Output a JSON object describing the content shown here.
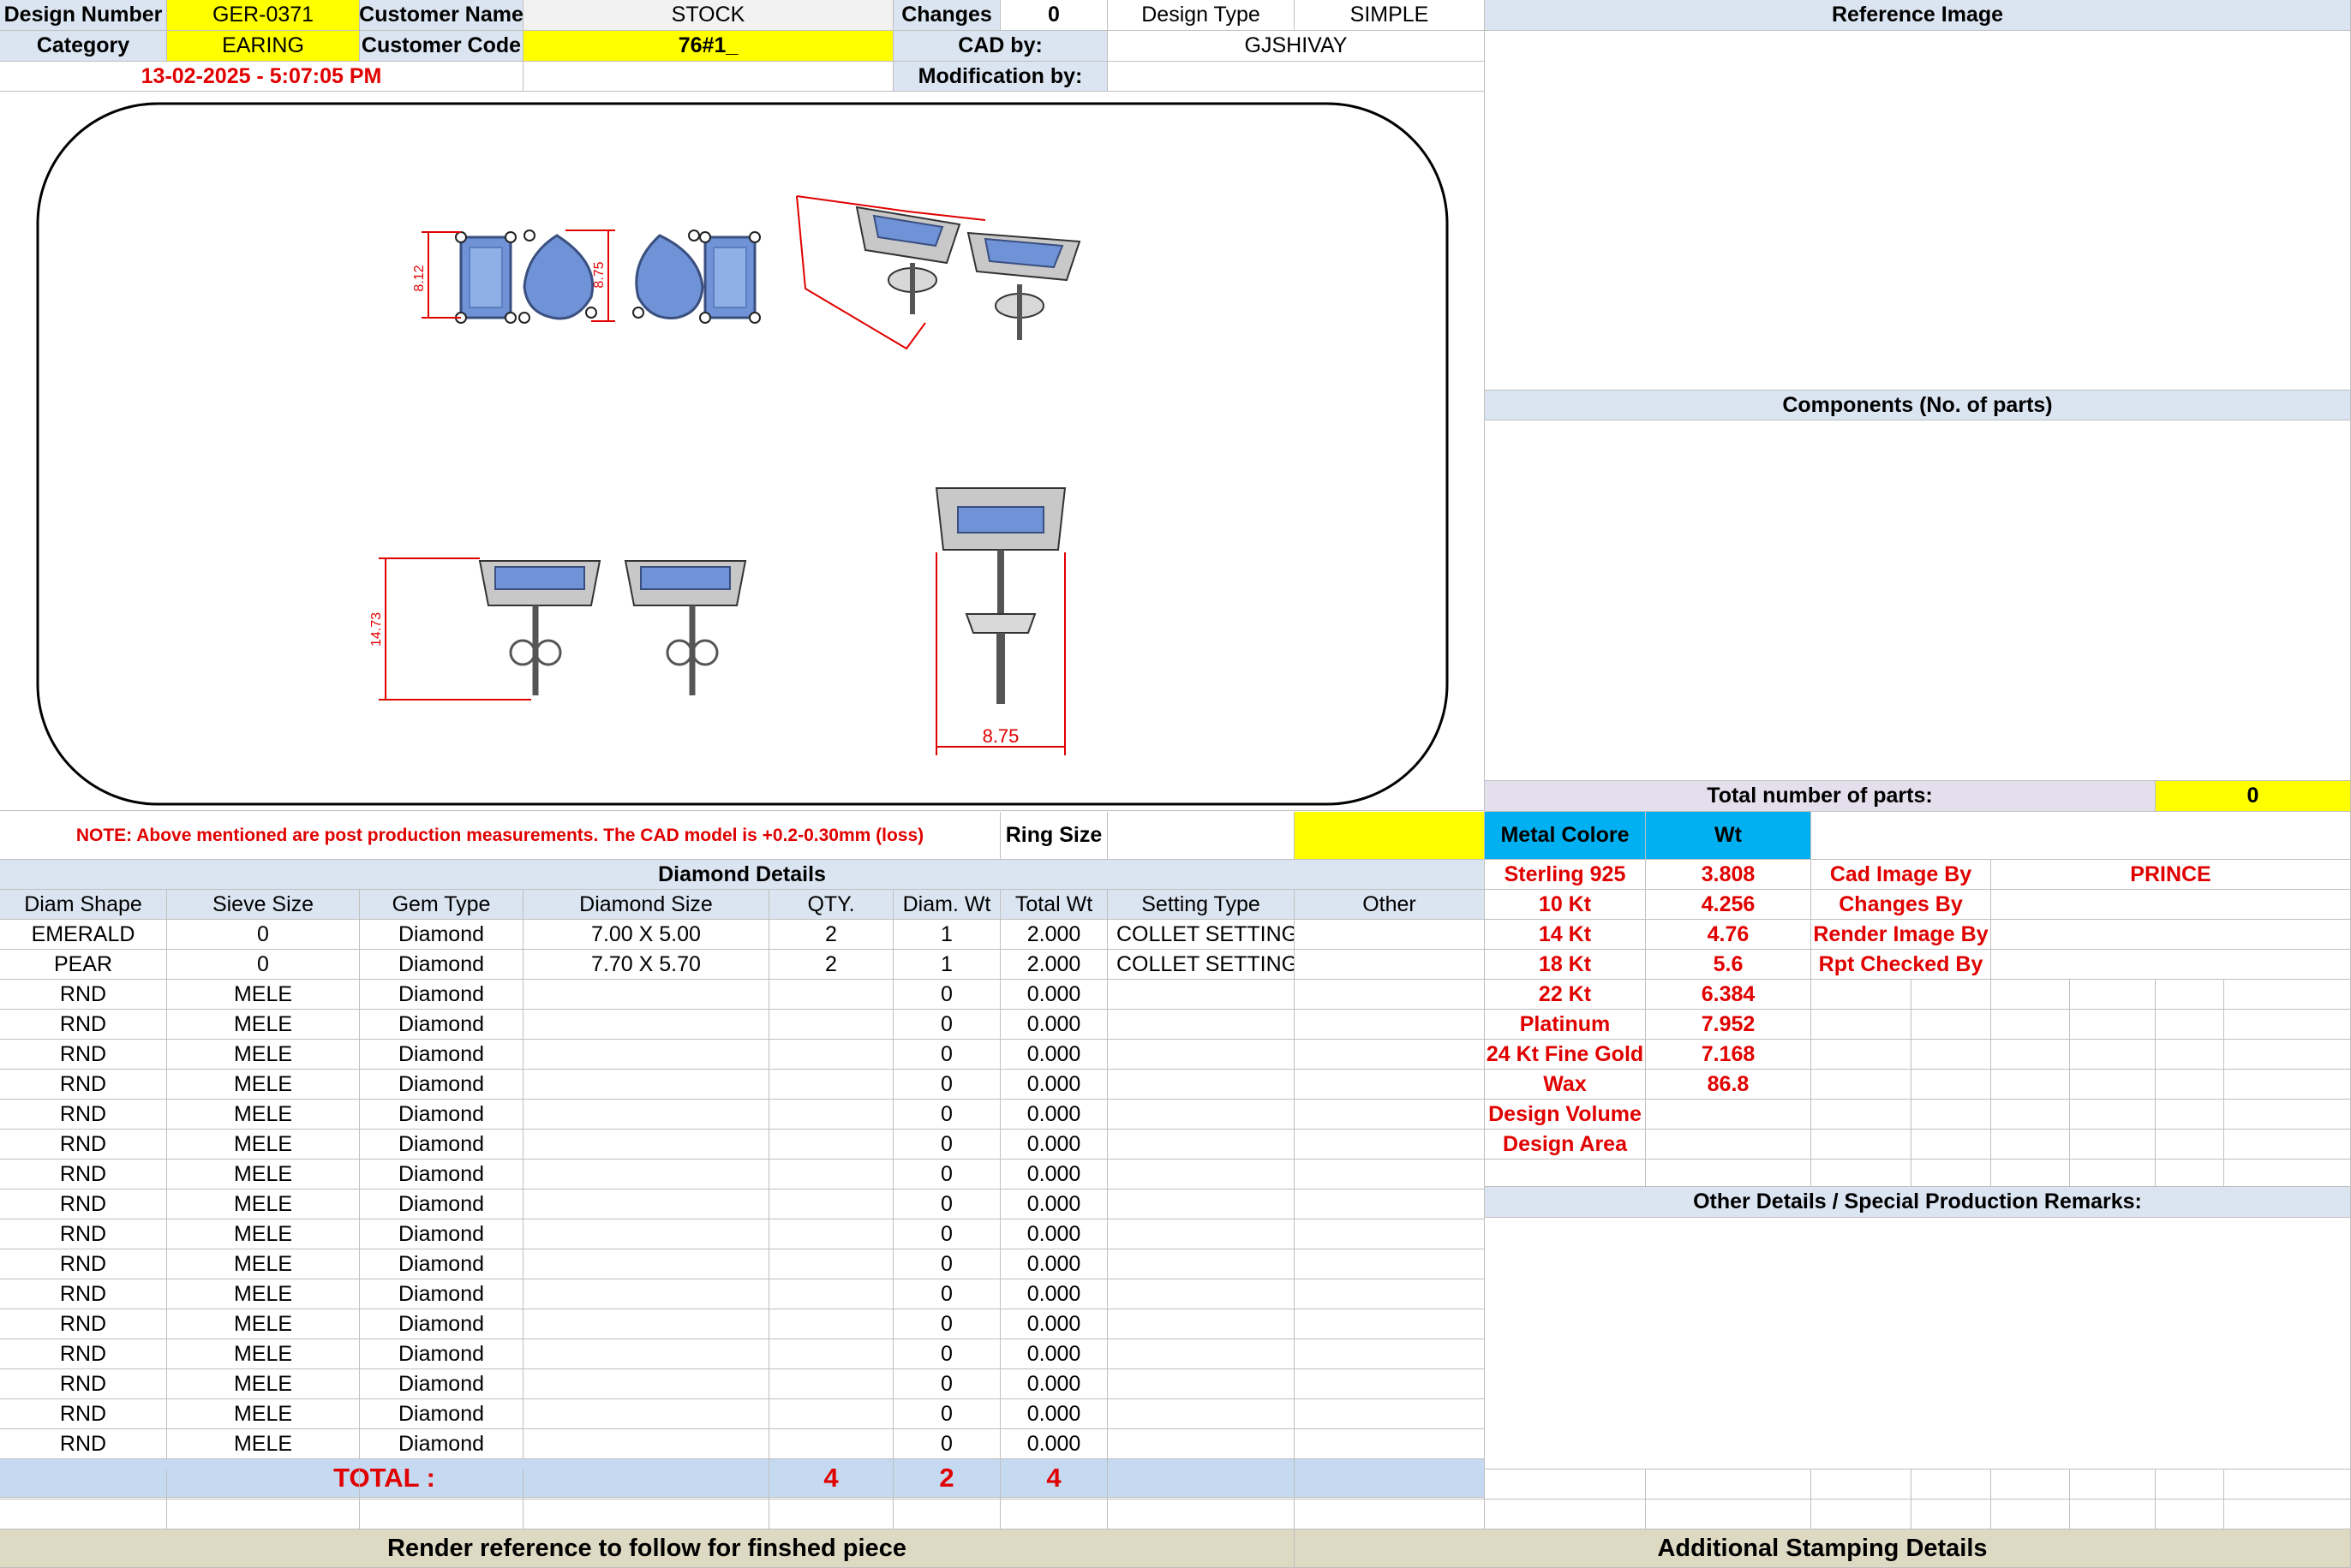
{
  "header": {
    "design_number_label": "Design Number",
    "design_number": "GER-0371",
    "customer_name_label": "Customer Name",
    "customer_name": "STOCK",
    "changes_label": "Changes",
    "changes": "0",
    "design_type_label": "Design Type",
    "design_type": "SIMPLE",
    "reference_image_label": "Reference Image",
    "category_label": "Category",
    "category": "EARING",
    "customer_code_label": "Customer Code",
    "customer_code": "76#1_",
    "cad_by_label": "CAD by:",
    "cad_by": "GJSHIVAY",
    "datetime": "13-02-2025 - 5:07:05 PM",
    "modification_by_label": "Modification by:",
    "modification_by": ""
  },
  "drawing": {
    "dim_height_1": "8.12",
    "dim_height_2": "8.75",
    "dim_side": "14.73",
    "dim_width": "8.75",
    "stone_color": "#6f93d6",
    "metal_color": "#c8c8c8",
    "dim_color": "#e00000"
  },
  "components": {
    "title": "Components (No. of parts)",
    "total_parts_label": "Total number of parts:",
    "total_parts": "0"
  },
  "note": {
    "text": "NOTE: Above mentioned are post production measurements. The CAD model is +0.2-0.30mm (loss)",
    "ring_size_label": "Ring Size",
    "ring_size": ""
  },
  "metal": {
    "colore_label": "Metal Colore",
    "wt_label": "Wt",
    "rows": [
      {
        "name": "Sterling 925",
        "wt": "3.808"
      },
      {
        "name": "10 Kt",
        "wt": "4.256"
      },
      {
        "name": "14 Kt",
        "wt": "4.76"
      },
      {
        "name": "18 Kt",
        "wt": "5.6"
      },
      {
        "name": "22 Kt",
        "wt": "6.384"
      },
      {
        "name": "Platinum",
        "wt": "7.952"
      },
      {
        "name": "24 Kt Fine Gold",
        "wt": "7.168"
      },
      {
        "name": "Wax",
        "wt": "86.8"
      },
      {
        "name": "Design Volume",
        "wt": ""
      },
      {
        "name": "Design Area",
        "wt": ""
      }
    ]
  },
  "credits": [
    {
      "label": "Cad Image By",
      "value": "PRINCE"
    },
    {
      "label": "Changes By",
      "value": ""
    },
    {
      "label": "Render Image By",
      "value": ""
    },
    {
      "label": "Rpt Checked By",
      "value": ""
    }
  ],
  "diamond": {
    "title": "Diamond Details",
    "columns": [
      "Diam Shape",
      "Sieve Size",
      "Gem Type",
      "Diamond Size",
      "QTY.",
      "Diam. Wt",
      "Total Wt",
      "Setting Type",
      "Other"
    ],
    "rows": [
      [
        "EMERALD",
        "0",
        "Diamond",
        "7.00 X 5.00",
        "2",
        "1",
        "2.000",
        "COLLET SETTING",
        ""
      ],
      [
        "PEAR",
        "0",
        "Diamond",
        "7.70 X 5.70",
        "2",
        "1",
        "2.000",
        "COLLET SETTING",
        ""
      ],
      [
        "RND",
        "MELE",
        "Diamond",
        "",
        "",
        "0",
        "0.000",
        "",
        ""
      ],
      [
        "RND",
        "MELE",
        "Diamond",
        "",
        "",
        "0",
        "0.000",
        "",
        ""
      ],
      [
        "RND",
        "MELE",
        "Diamond",
        "",
        "",
        "0",
        "0.000",
        "",
        ""
      ],
      [
        "RND",
        "MELE",
        "Diamond",
        "",
        "",
        "0",
        "0.000",
        "",
        ""
      ],
      [
        "RND",
        "MELE",
        "Diamond",
        "",
        "",
        "0",
        "0.000",
        "",
        ""
      ],
      [
        "RND",
        "MELE",
        "Diamond",
        "",
        "",
        "0",
        "0.000",
        "",
        ""
      ],
      [
        "RND",
        "MELE",
        "Diamond",
        "",
        "",
        "0",
        "0.000",
        "",
        ""
      ],
      [
        "RND",
        "MELE",
        "Diamond",
        "",
        "",
        "0",
        "0.000",
        "",
        ""
      ],
      [
        "RND",
        "MELE",
        "Diamond",
        "",
        "",
        "0",
        "0.000",
        "",
        ""
      ],
      [
        "RND",
        "MELE",
        "Diamond",
        "",
        "",
        "0",
        "0.000",
        "",
        ""
      ],
      [
        "RND",
        "MELE",
        "Diamond",
        "",
        "",
        "0",
        "0.000",
        "",
        ""
      ],
      [
        "RND",
        "MELE",
        "Diamond",
        "",
        "",
        "0",
        "0.000",
        "",
        ""
      ],
      [
        "RND",
        "MELE",
        "Diamond",
        "",
        "",
        "0",
        "0.000",
        "",
        ""
      ],
      [
        "RND",
        "MELE",
        "Diamond",
        "",
        "",
        "0",
        "0.000",
        "",
        ""
      ],
      [
        "RND",
        "MELE",
        "Diamond",
        "",
        "",
        "0",
        "0.000",
        "",
        ""
      ],
      [
        "RND",
        "MELE",
        "Diamond",
        "",
        "",
        "0",
        "0.000",
        "",
        ""
      ]
    ],
    "total_label": "TOTAL :",
    "total_qty": "4",
    "total_diam_wt": "2",
    "total_wt": "4"
  },
  "other_details": {
    "title": "Other Details / Special Production Remarks:"
  },
  "footer": {
    "render_reference": "Render reference to follow for finshed piece",
    "stamping": "Additional Stamping Details"
  }
}
